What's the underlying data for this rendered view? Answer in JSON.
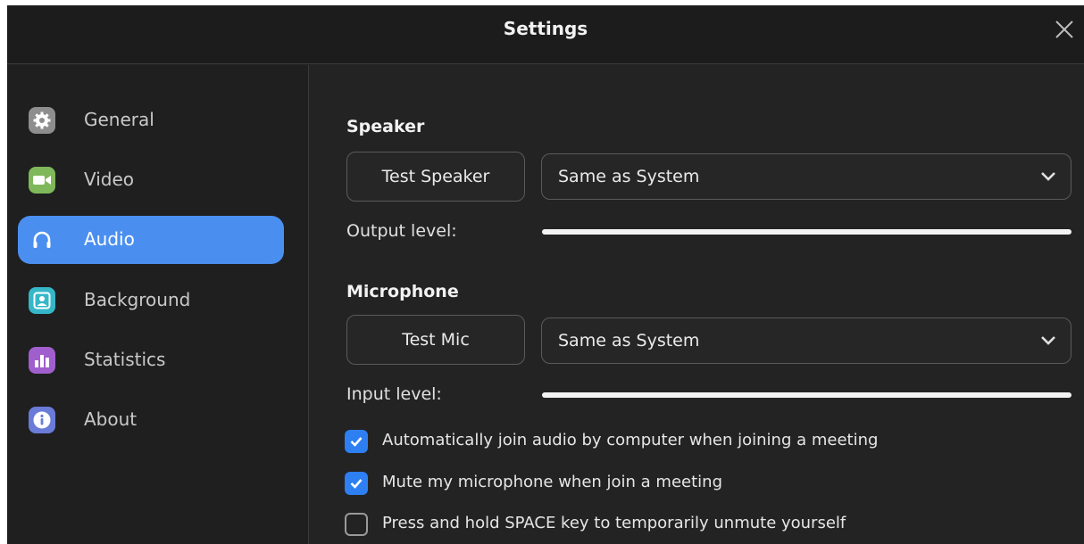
{
  "window": {
    "title": "Settings"
  },
  "sidebar": {
    "items": [
      {
        "label": "General",
        "icon": "gear-icon",
        "color": "#8e8e8e",
        "active": false
      },
      {
        "label": "Video",
        "icon": "video-camera-icon",
        "color": "#7fb85a",
        "active": false
      },
      {
        "label": "Audio",
        "icon": "headphones-icon",
        "color": "#4a8ff0",
        "active": true
      },
      {
        "label": "Background",
        "icon": "portrait-icon",
        "color": "#36b7c8",
        "active": false
      },
      {
        "label": "Statistics",
        "icon": "bar-chart-icon",
        "color": "#a15fce",
        "active": false
      },
      {
        "label": "About",
        "icon": "info-icon",
        "color": "#6a7bd8",
        "active": false
      }
    ]
  },
  "speaker": {
    "heading": "Speaker",
    "test_button": "Test Speaker",
    "device": "Same as System",
    "level_label": "Output level:",
    "level": 0
  },
  "microphone": {
    "heading": "Microphone",
    "test_button": "Test Mic",
    "device": "Same as System",
    "level_label": "Input level:",
    "level": 0
  },
  "options": [
    {
      "label": "Automatically join audio by computer when joining a meeting",
      "checked": true
    },
    {
      "label": "Mute my microphone when join a meeting",
      "checked": true
    },
    {
      "label": "Press and hold SPACE key to temporarily unmute yourself",
      "checked": false
    }
  ],
  "colors": {
    "accent": "#4a8ff0",
    "checkbox": "#2d7ff2",
    "background": "#232323"
  }
}
